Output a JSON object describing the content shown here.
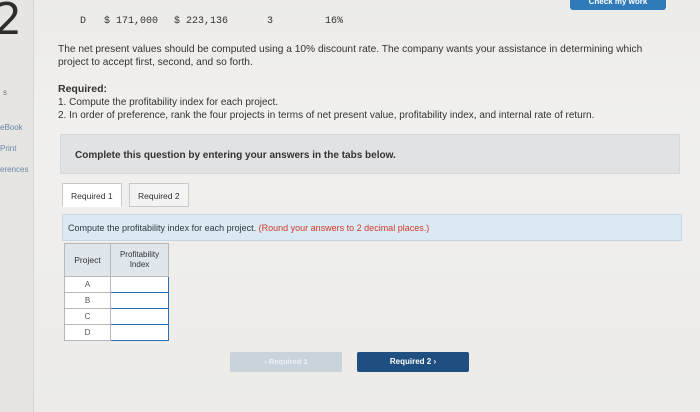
{
  "question_number": "2",
  "check_button": "Check my work",
  "side_links": {
    "marker": "s",
    "ebook": "eBook",
    "print": "Print",
    "references": "erences"
  },
  "data_row": {
    "project": "D",
    "investment": "$ 171,000",
    "pv": "$ 223,136",
    "life": "3",
    "irr": "16%"
  },
  "paragraph": "The net present values should be computed using a 10% discount rate. The company wants your assistance in determining which project to accept first, second, and so forth.",
  "required_heading": "Required:",
  "required_items": [
    "1. Compute the profitability index for each project.",
    "2. In order of preference, rank the four projects in terms of net present value, profitability index, and internal rate of return."
  ],
  "panel_text": "Complete this question by entering your answers in the tabs below.",
  "tabs": [
    "Required 1",
    "Required 2"
  ],
  "instruction": "Compute the profitability index for each project.",
  "instruction_note": "(Round your answers to 2 decimal places.)",
  "table": {
    "headers": [
      "Project",
      "Profitability Index"
    ],
    "rows": [
      "A",
      "B",
      "C",
      "D"
    ]
  },
  "nav": {
    "prev": "Required 1",
    "next": "Required 2"
  },
  "colors": {
    "accent": "#1e4f80",
    "instruction_bg": "#dbe9f2",
    "note_red": "#d23a2a"
  }
}
